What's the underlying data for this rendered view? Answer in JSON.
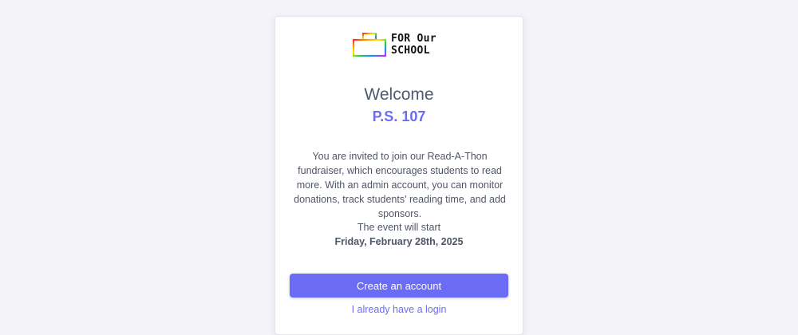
{
  "logo": {
    "icon": "rainbow-school-icon",
    "line1": "FOR Our",
    "line2": "SCHOOL"
  },
  "header": {
    "welcome": "Welcome",
    "school_name": "P.S. 107"
  },
  "body": {
    "invite_text": "You are invited to join our Read-A-Thon fundraiser, which encourages students to read more. With an admin account, you can monitor donations, track students' reading time, and add sponsors.",
    "event_label": "The event will start",
    "event_date": "Friday, February 28th, 2025"
  },
  "actions": {
    "create_account": "Create an account",
    "login": "I already have a login"
  },
  "colors": {
    "accent": "#6a6cf6",
    "text": "#4e5668",
    "background": "#f3f3f9"
  }
}
